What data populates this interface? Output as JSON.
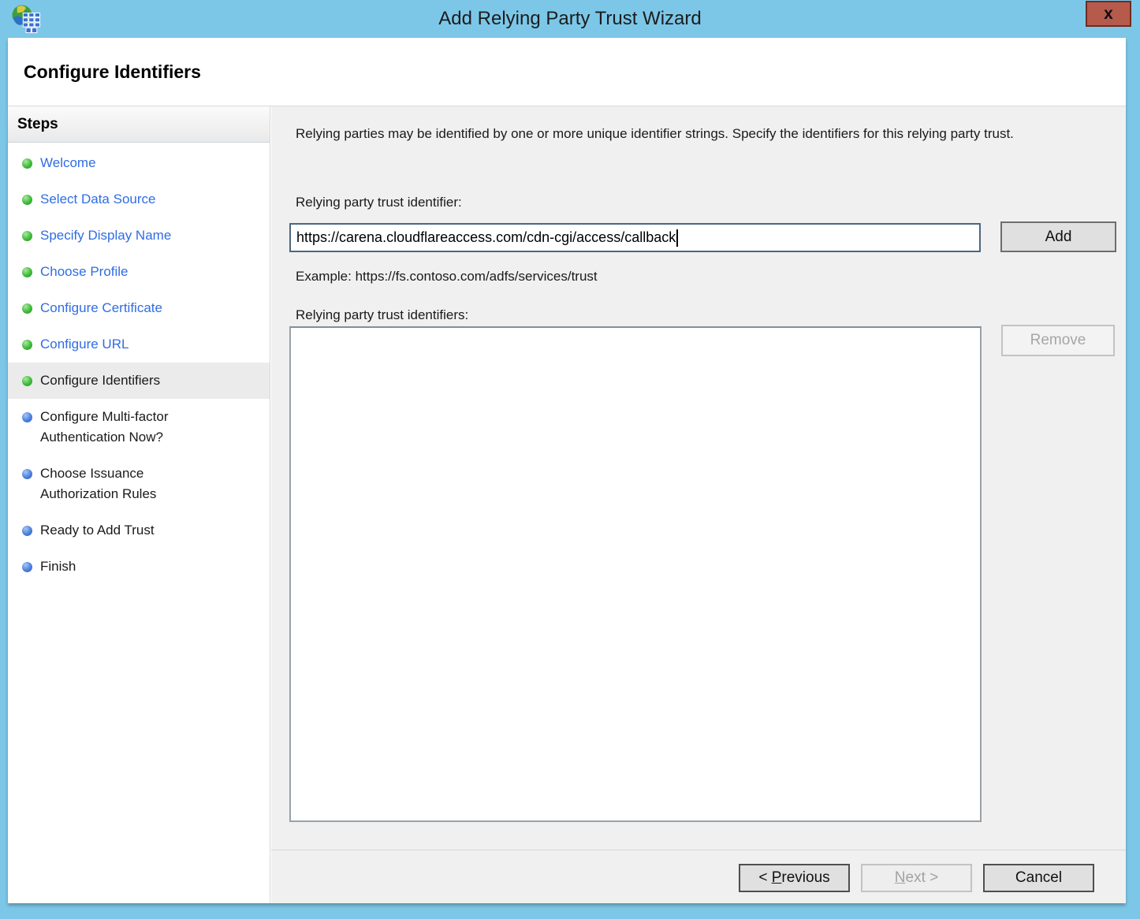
{
  "window": {
    "title": "Add Relying Party Trust Wizard",
    "close_label": "x"
  },
  "page": {
    "heading": "Configure Identifiers"
  },
  "sidebar": {
    "heading": "Steps",
    "items": [
      {
        "label": "Welcome",
        "status": "done"
      },
      {
        "label": "Select Data Source",
        "status": "done"
      },
      {
        "label": "Specify Display Name",
        "status": "done"
      },
      {
        "label": "Choose Profile",
        "status": "done"
      },
      {
        "label": "Configure Certificate",
        "status": "done"
      },
      {
        "label": "Configure URL",
        "status": "done"
      },
      {
        "label": "Configure Identifiers",
        "status": "current"
      },
      {
        "label": "Configure Multi-factor Authentication Now?",
        "status": "pending"
      },
      {
        "label": "Choose Issuance Authorization Rules",
        "status": "pending"
      },
      {
        "label": "Ready to Add Trust",
        "status": "pending"
      },
      {
        "label": "Finish",
        "status": "pending"
      }
    ]
  },
  "main": {
    "description": "Relying parties may be identified by one or more unique identifier strings. Specify the identifiers for this relying party trust.",
    "identifier_label": "Relying party trust identifier:",
    "identifier_value": "https://carena.cloudflareaccess.com/cdn-cgi/access/callback",
    "add_button": "Add",
    "example": "Example: https://fs.contoso.com/adfs/services/trust",
    "identifiers_list_label": "Relying party trust identifiers:",
    "identifiers": [],
    "remove_button": "Remove"
  },
  "footer": {
    "previous_button": {
      "prefix": "< ",
      "key": "P",
      "rest": "revious"
    },
    "next_button": {
      "key": "N",
      "rest": "ext >"
    },
    "cancel_button": "Cancel"
  },
  "colors": {
    "titlebar_blue": "#7cc7e8",
    "close_button_red": "#b65a4c",
    "link_blue": "#2f6de3",
    "done_step_dot_green": "#3fba39",
    "pending_step_dot_blue": "#4a80dd",
    "content_background": "#f0f0f0",
    "focused_input_border": "#4c677f",
    "current_step_highlight": "#ebebeb"
  }
}
